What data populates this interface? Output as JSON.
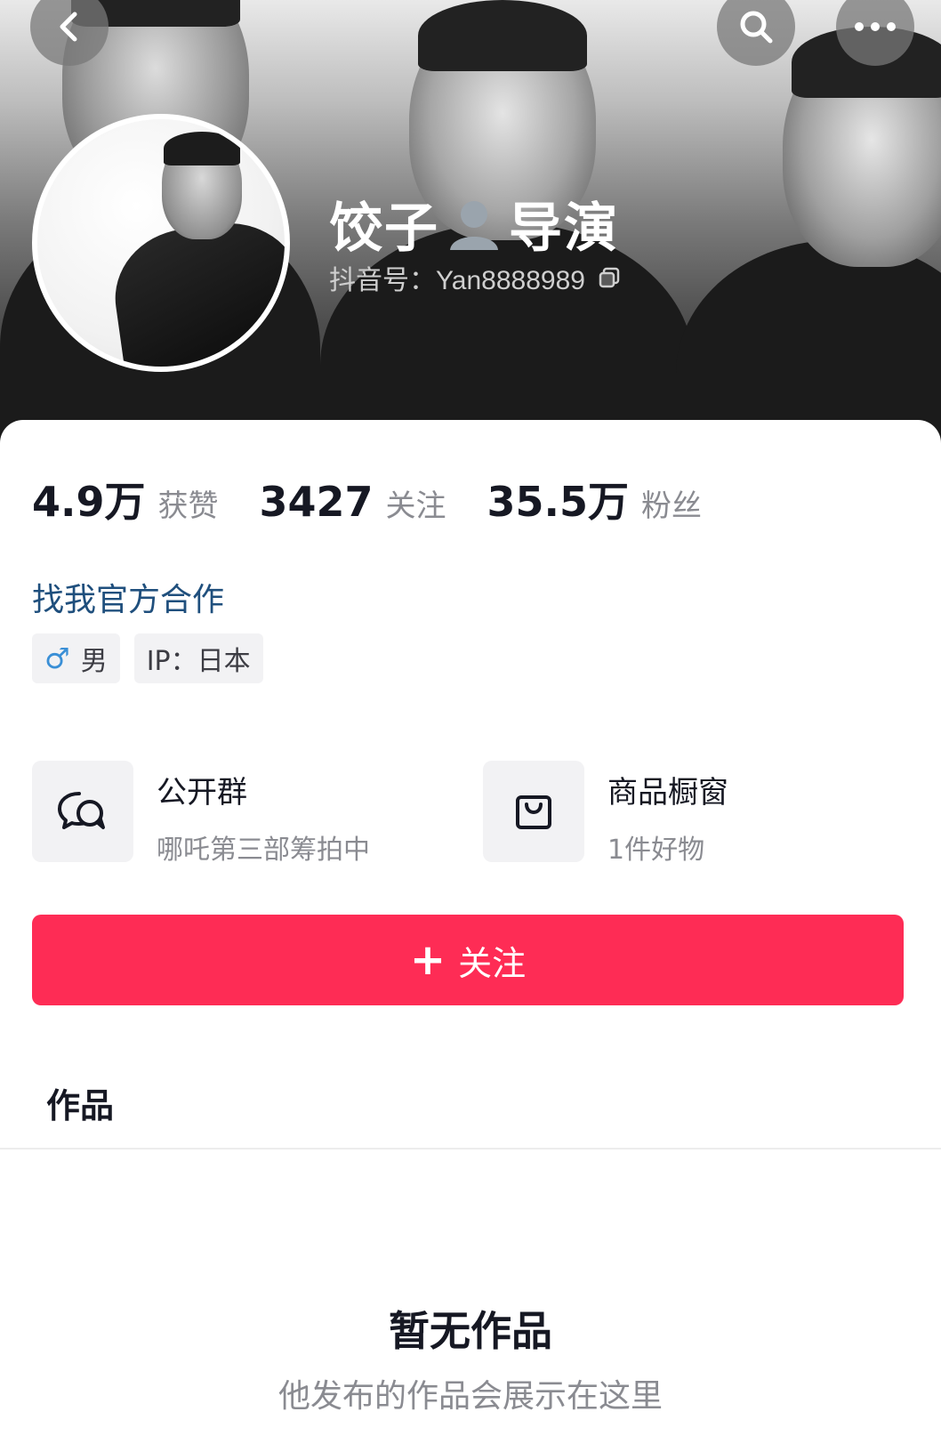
{
  "profile": {
    "name_part1": "饺子",
    "name_part2": "导演",
    "handle": "抖音号：Yan8888989",
    "stats": [
      {
        "num": "4.9万",
        "label": "获赞"
      },
      {
        "num": "3427",
        "label": "关注"
      },
      {
        "num": "35.5万",
        "label": "粉丝"
      }
    ],
    "cooperation_link": "找我官方合作",
    "tags": {
      "gender_symbol": "♂",
      "gender": "男",
      "ip": "IP：日本"
    }
  },
  "features": {
    "group": {
      "title": "公开群",
      "subtitle": "哪吒第三部筹拍中",
      "icon": "chat-bubbles-icon"
    },
    "shop": {
      "title": "商品橱窗",
      "subtitle": "1件好物",
      "icon": "shopping-bag-icon"
    }
  },
  "follow_button": {
    "plus": "+",
    "label": "关注"
  },
  "tabs": {
    "works": "作品"
  },
  "empty_state": {
    "title": "暂无作品",
    "subtitle": "他发布的作品会展示在这里"
  },
  "colors": {
    "accent": "#fe2c55",
    "link": "#1f4f7d",
    "male_symbol": "#3a8fd6"
  }
}
